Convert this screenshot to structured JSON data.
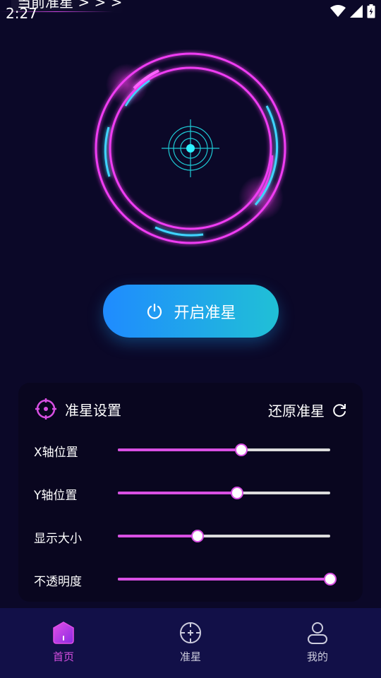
{
  "statusbar": {
    "title": "当前准星 > > >",
    "time": "2:27"
  },
  "main_button": {
    "label": "开启准星"
  },
  "settings": {
    "title": "准星设置",
    "reset_label": "还原准星",
    "sliders": [
      {
        "label": "X轴位置",
        "value": 0.58
      },
      {
        "label": "Y轴位置",
        "value": 0.56
      },
      {
        "label": "显示大小",
        "value": 0.375
      },
      {
        "label": "不透明度",
        "value": 1.0
      }
    ]
  },
  "nav": [
    {
      "label": "首页",
      "icon": "home-icon",
      "active": true
    },
    {
      "label": "准星",
      "icon": "crosshair-icon",
      "active": false
    },
    {
      "label": "我的",
      "icon": "user-icon",
      "active": false
    }
  ],
  "colors": {
    "accent": "#d84fe3",
    "button_from": "#1f8bff",
    "button_to": "#20c0d6",
    "ring_cyan": "#3fd4ff",
    "background": "#0b0828"
  }
}
